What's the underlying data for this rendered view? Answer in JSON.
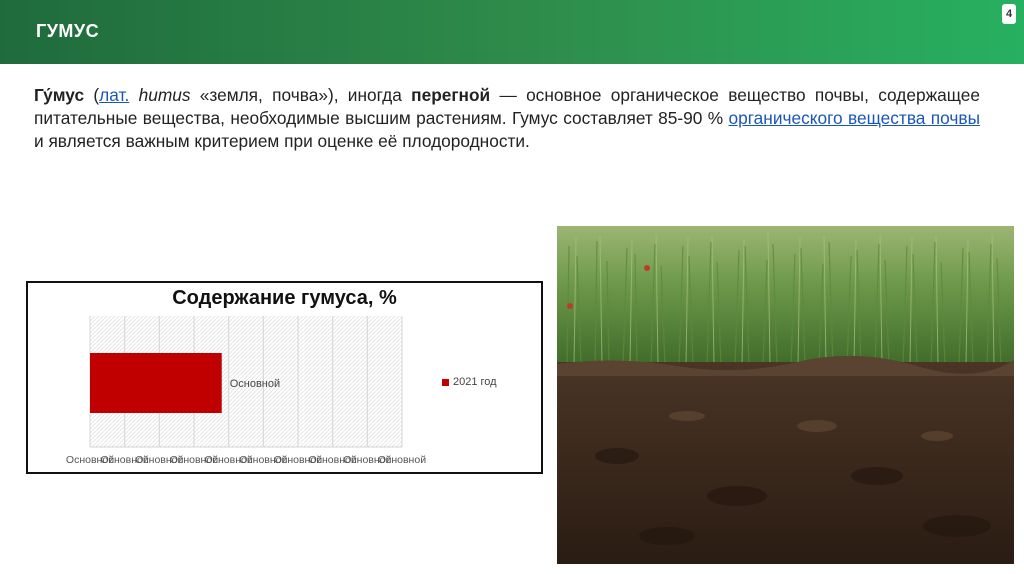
{
  "header": {
    "title": "ГУМУС",
    "page_number": "4"
  },
  "paragraph": {
    "term": "Гу́мус",
    "open": " (",
    "lat_link": "лат.",
    "latin_word": " humus",
    "meaning": " «земля, почва»), иногда ",
    "synonym": "перегной",
    "definition": " — основное органическое вещество почвы, содержащее питательные вещества, необходимые высшим растениям. Гумус составляет 85-90 % ",
    "link2": "органического вещества почвы",
    "end": " и является важным критерием при оценке её плодородности."
  },
  "chart_data": {
    "type": "bar",
    "orientation": "horizontal",
    "title": "Содержание гумуса, %",
    "categories": [
      "Основной"
    ],
    "series": [
      {
        "name": "2021 год",
        "values": [
          3.8
        ],
        "color": "#c00000"
      }
    ],
    "xlim": [
      0,
      9
    ],
    "x_tick_labels": [
      "Основной",
      "Основной",
      "Основной",
      "Основной",
      "Основной",
      "Основной",
      "Основной",
      "Основной",
      "Основной",
      "Основной"
    ],
    "grid": true,
    "legend_position": "right"
  }
}
